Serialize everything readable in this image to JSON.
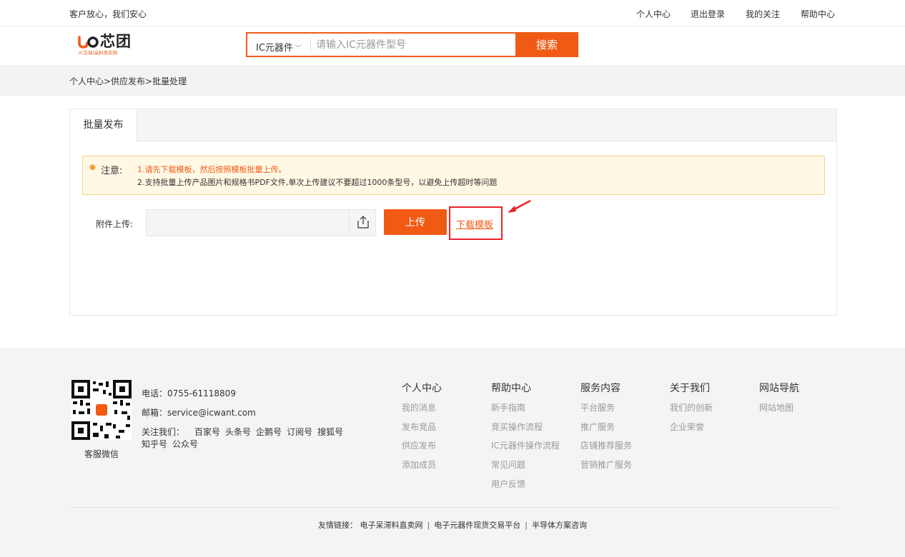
{
  "topbar": {
    "slogan": "客户放心，我们安心",
    "links": [
      "个人中心",
      "退出登录",
      "我的关注",
      "帮助中心"
    ]
  },
  "logo": {
    "main_pre": "",
    "main_text": "芯团",
    "sub": "IC交易|采料竞买网",
    "brand_color": "#f05a14"
  },
  "search": {
    "category": "IC元器件",
    "placeholder": "请输入IC元器件型号",
    "button": "搜索"
  },
  "breadcrumb": "个人中心>供应发布>批量处理",
  "tab": {
    "label": "批量发布"
  },
  "notice": {
    "label": "注意:",
    "line1": "1.请先下载模板，然后按照模板批量上传。",
    "line2": "2.支持批量上传产品图片和规格书PDF文件,单次上传建议不要超过1000条型号，以避免上传超时等问题"
  },
  "upload": {
    "label": "附件上传:",
    "button": "上传",
    "download": "下载模板"
  },
  "footer": {
    "qr_caption": "客服微信",
    "phone": "电话：0755-61118809",
    "email": "邮箱：service@icwant.com",
    "follow_label": "关注我们：",
    "follow_items": [
      "百家号",
      "头条号",
      "企鹅号",
      "订阅号",
      "搜狐号"
    ],
    "follow_items2": [
      "知乎号",
      "公众号"
    ],
    "columns": [
      {
        "title": "个人中心",
        "items": [
          "我的消息",
          "发布竞品",
          "供应发布",
          "添加成员"
        ]
      },
      {
        "title": "帮助中心",
        "items": [
          "新手指南",
          "竞买操作流程",
          "IC元器件操作流程",
          "常见问题",
          "用户反馈"
        ]
      },
      {
        "title": "服务内容",
        "items": [
          "平台服务",
          "推广服务",
          "店铺推荐服务",
          "营销推广服务"
        ]
      },
      {
        "title": "关于我们",
        "items": [
          "我们的创新",
          "企业荣誉"
        ]
      },
      {
        "title": "网站导航",
        "items": [
          "网站地图"
        ]
      }
    ],
    "friendlinks_label": "友情链接：",
    "friendlinks": [
      "电子呆滞料直卖网",
      "电子元器件现货交易平台",
      "半导体方案咨询"
    ]
  }
}
